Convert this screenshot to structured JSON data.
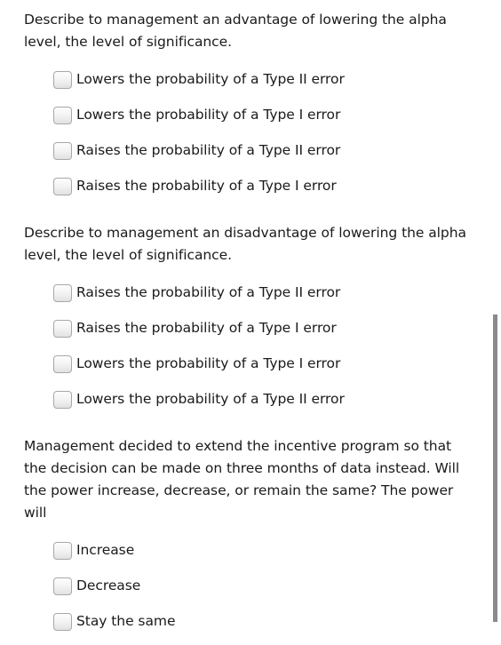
{
  "page": {
    "background_color": "#ffffff",
    "text_color": "#1a1a1a"
  },
  "questions": [
    {
      "prompt": "Describe to management an advantage of lowering the alpha level, the level of significance.",
      "options": [
        "Lowers the probability of a Type II error",
        "Lowers the probability of a Type I error",
        "Raises the probability of a Type II error",
        "Raises the probability of a Type I error"
      ]
    },
    {
      "prompt": "Describe to management an disadvantage of lowering the alpha level, the level of significance.",
      "options": [
        "Raises the probability of a Type II error",
        "Raises the probability of a Type I error",
        "Lowers the probability of a Type I error",
        "Lowers the probability of a Type II error"
      ]
    },
    {
      "prompt": "Management decided to extend the incentive program so that the decision can be made on three months of data instead. Will the power increase, decrease, or remain the same? The power will",
      "options": [
        "Increase",
        "Decrease",
        "Stay the same"
      ]
    }
  ],
  "scrollbar": {
    "orientation": "vertical",
    "thumb_color": "#8a8a8a",
    "track_color": "#ffffff"
  }
}
